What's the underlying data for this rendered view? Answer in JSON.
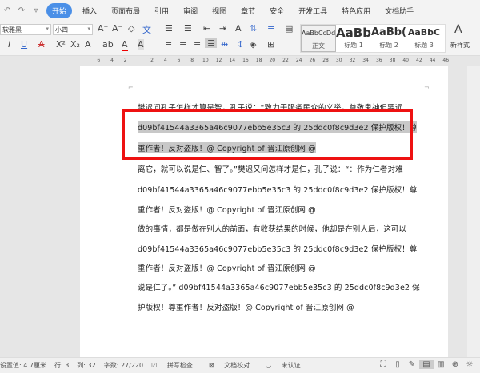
{
  "menu": {
    "quick_icons": [
      "undo-icon",
      "redo-icon",
      "dropdown-icon"
    ],
    "tabs": [
      "开始",
      "插入",
      "页面布局",
      "引用",
      "审阅",
      "视图",
      "章节",
      "安全",
      "开发工具",
      "特色应用",
      "文档助手"
    ],
    "active_tab": "开始"
  },
  "toolbar": {
    "font_name": "软雅黑",
    "font_size": "小四",
    "styles": [
      {
        "preview": "AaBbCcDd",
        "label": "正文"
      },
      {
        "preview": "AaBb",
        "label": "标题 1"
      },
      {
        "preview": "AaBb(",
        "label": "标题 2"
      },
      {
        "preview": "AaBbC",
        "label": "标题 3"
      }
    ],
    "new_style": "新样式"
  },
  "ruler": {
    "ticks": [
      "6",
      "4",
      "2",
      "",
      "2",
      "4",
      "6",
      "8",
      "10",
      "12",
      "14",
      "16",
      "18",
      "20",
      "22",
      "24",
      "26",
      "28",
      "30",
      "32",
      "34",
      "36",
      "38",
      "40",
      "42",
      "44",
      "46"
    ]
  },
  "document": {
    "lines": [
      "樊迟问孔子怎样才算是智，孔子说：“致力于服务民众的义举，尊敬鬼神但要远",
      "d09bf41544a3365a46c9077ebb5e35c3 的 25ddc0f8c9d3e2  保护版权！尊",
      "重作者！反对盗版！@ Copyright of  晋江原创网  @",
      "离它，就可以说是仁、智了。”樊迟又问怎样才是仁，孔子说：“：作为仁者对难",
      "d09bf41544a3365a46c9077ebb5e35c3 的 25ddc0f8c9d3e2  保护版权！尊",
      "重作者！反对盗版！@ Copyright of  晋江原创网  @",
      "做的事情，都是做在别人的前面，有收获结果的时候，他却是在别人后，这可以",
      "d09bf41544a3365a46c9077ebb5e35c3 的 25ddc0f8c9d3e2  保护版权！尊",
      "重作者！反对盗版！@ Copyright of  晋江原创网  @",
      "说是仁了。” d09bf41544a3365a46c9077ebb5e35c3 的 25ddc0f8c9d3e2  保",
      "护版权！尊重作者！反对盗版！@ Copyright of  晋江原创网  @"
    ],
    "highlighted_lines": [
      1,
      2
    ]
  },
  "status": {
    "position": "设置值: 4.7厘米",
    "row": "行: 3",
    "col": "列: 32",
    "word_count": "字数: 27/220",
    "spell_check": "拼写检查",
    "doc_check": "文档校对",
    "auth": "未认证"
  },
  "colors": {
    "accent": "#4a8fe7",
    "highlight": "#c8c8c8",
    "annotation": "#e11111"
  }
}
